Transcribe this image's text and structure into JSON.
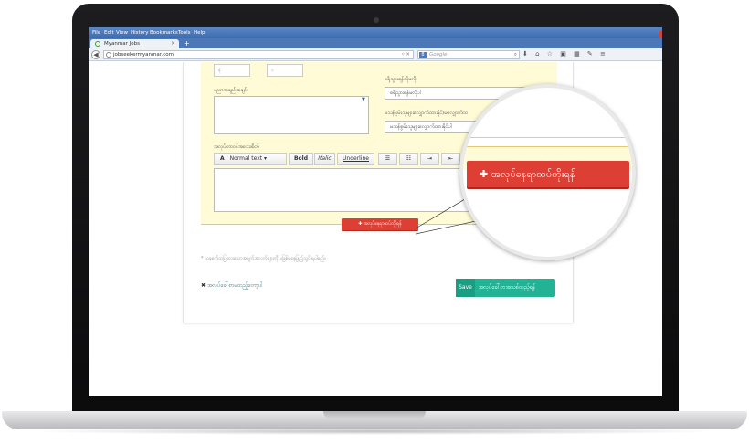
{
  "browser": {
    "menu": [
      "File",
      "Edit",
      "View",
      "History",
      "Bookmarks",
      "Tools",
      "Help"
    ],
    "tab_title": "Myanmar Jobs",
    "tab_close": "×",
    "new_tab": "+",
    "url": "jobseekermyanmar.com",
    "search_engine": "8",
    "search_placeholder": "Google",
    "window_buttons": [
      "–",
      "□",
      "×"
    ]
  },
  "form": {
    "small_field_1": "နံ",
    "small_field_2": "ဝ",
    "education_label": "ပညာအရည်အချင်း",
    "salary_label": "စရိုသွားရန်လိုမလို",
    "salary_value": "စရိုသွားရန်မလိုပါ",
    "other_label": "မသန်စွမ်းသူများလျှောက်ထားနိုင်/မလျှောက်ထ",
    "other_value": "မသန်စွမ်းသူများလျှောက်ထားနိုင်ပါ",
    "description_label": "အလုပ်တာဝန်အသေးစိတ်",
    "toolbar": {
      "font_icon": "A",
      "style": "Normal text",
      "bold": "Bold",
      "italic": "Italic",
      "underline": "Underline"
    },
    "add_position_button": "အလုပ်နေရာထပ်တိုးရန်",
    "note": "* သခင်္ကေတပြထားသောအချက်အလက်များကို မဖြစ်မနေဖြည့်သွင်းရပါမည်။",
    "cancel_link": "အလုပ်ခေါ်စာမထည့်တော့ပါ",
    "save_label": "Save",
    "publish_label": "အလုပ်ခေါ်စာအသစ်ထည့်ရန်"
  },
  "magnifier": {
    "button_label": "အလုပ်နေရာထပ်တိုးရန်"
  },
  "colors": {
    "accent_red": "#de3f34",
    "save_green": "#21b394",
    "highlight_yellow": "#fffbd6",
    "firefox_blue": "#4c78b8"
  }
}
